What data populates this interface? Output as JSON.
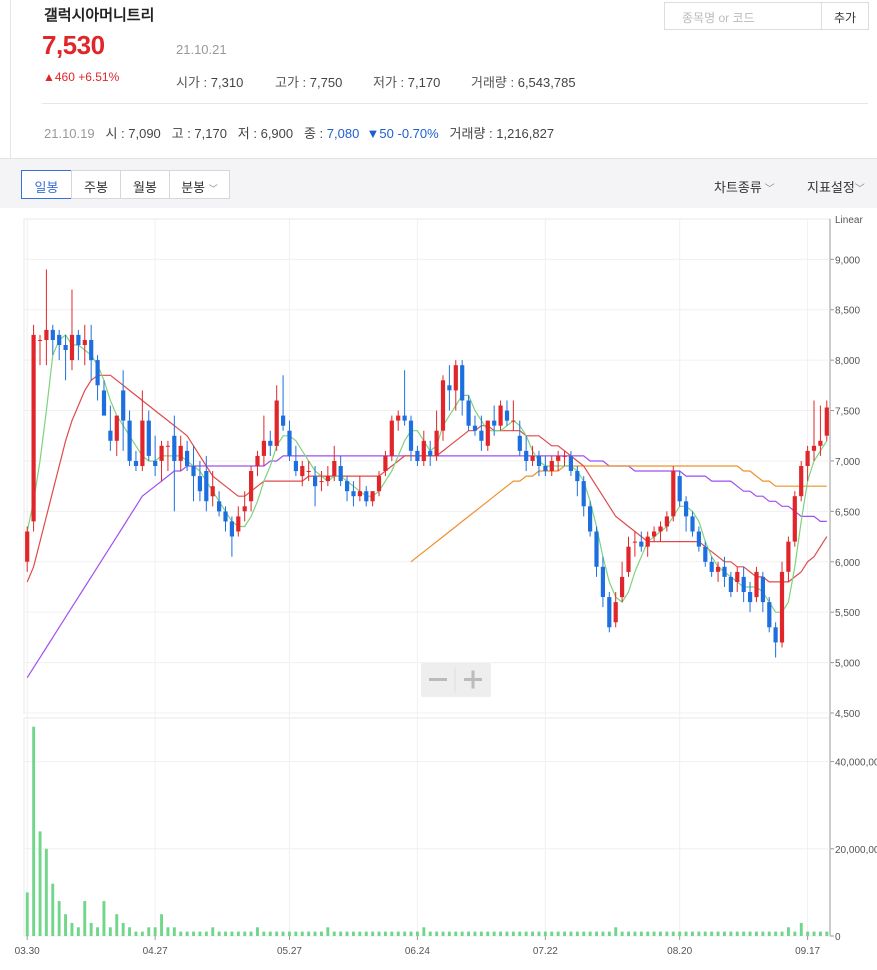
{
  "header": {
    "stock_name": "갤럭시아머니트리",
    "price": "7,530",
    "date": "21.10.21",
    "change": "▲460 +6.51%",
    "open_label": "시가 : ",
    "open": "7,310",
    "high_label": "고가 : ",
    "high": "7,750",
    "low_label": "저가 : ",
    "low": "7,170",
    "volume_label": "거래량 : ",
    "volume": "6,543,785"
  },
  "previous_day": {
    "date": "21.10.19",
    "open": "시 : 7,090",
    "high": "고 : 7,170",
    "low": "저 : 6,900",
    "close_label": "종 : ",
    "close": "7,080",
    "change": "▼50 -0.70%",
    "volume": "거래량 : 1,216,827"
  },
  "search": {
    "placeholder": "종목명 or 코드",
    "add_label": "추가"
  },
  "tabs": [
    {
      "label": "일봉",
      "active": true
    },
    {
      "label": "주봉",
      "active": false
    },
    {
      "label": "월봉",
      "active": false
    },
    {
      "label": "분봉",
      "active": false
    }
  ],
  "menus": {
    "chart_type": "차트종류",
    "indicator": "지표설정"
  },
  "colors": {
    "up": "#e0262a",
    "down": "#1d6fe0",
    "ma5": "#7dd37d",
    "ma20": "#e04a4a",
    "ma60": "#a14ff0",
    "ma120": "#f0902a",
    "volume": "#6fd68a"
  },
  "chart_data": {
    "type": "candlestick",
    "scale_label": "Linear",
    "price_ylim": [
      4500,
      9400
    ],
    "price_ticks": [
      "9,000",
      "8,500",
      "8,000",
      "7,500",
      "7,000",
      "6,500",
      "6,000",
      "5,500",
      "5,000",
      "4,500"
    ],
    "volume_ylim": [
      0,
      50000000
    ],
    "volume_ticks": [
      "40,000,00",
      "20,000,00",
      "0"
    ],
    "x_ticks": [
      "03.30",
      "04.27",
      "05.27",
      "06.24",
      "07.22",
      "08.20",
      "09.17"
    ],
    "candles": [
      [
        6000,
        6350,
        5900,
        6300
      ],
      [
        6400,
        8350,
        6300,
        8250
      ],
      [
        8200,
        8250,
        7950,
        8200
      ],
      [
        8200,
        8900,
        7950,
        8300
      ],
      [
        8300,
        8350,
        8050,
        8200
      ],
      [
        8250,
        8300,
        8000,
        8150
      ],
      [
        8150,
        8250,
        7800,
        8100
      ],
      [
        8000,
        8700,
        7900,
        8250
      ],
      [
        8250,
        8300,
        8000,
        8150
      ],
      [
        8150,
        8350,
        7950,
        8200
      ],
      [
        8200,
        8350,
        7800,
        8000
      ],
      [
        8000,
        8050,
        7600,
        7750
      ],
      [
        7700,
        7800,
        7450,
        7450
      ],
      [
        7300,
        7550,
        7100,
        7200
      ],
      [
        7200,
        7400,
        7050,
        7450
      ],
      [
        7700,
        7900,
        7100,
        7400
      ],
      [
        7400,
        7500,
        6950,
        7000
      ],
      [
        7000,
        7100,
        6900,
        6950
      ],
      [
        6950,
        7700,
        6900,
        7400
      ],
      [
        7400,
        7500,
        7000,
        7050
      ],
      [
        7000,
        7250,
        6850,
        6950
      ],
      [
        7000,
        7200,
        6800,
        7150
      ],
      [
        7150,
        7200,
        6900,
        7150
      ],
      [
        7250,
        7450,
        6500,
        7000
      ],
      [
        7000,
        7250,
        6900,
        7150
      ],
      [
        7100,
        7200,
        6900,
        6950
      ],
      [
        6950,
        7150,
        6600,
        6850
      ],
      [
        6850,
        7000,
        6600,
        6700
      ],
      [
        6900,
        7050,
        6500,
        6600
      ],
      [
        6650,
        6900,
        6550,
        6750
      ],
      [
        6600,
        6700,
        6450,
        6500
      ],
      [
        6500,
        6550,
        6300,
        6400
      ],
      [
        6400,
        6450,
        6050,
        6250
      ],
      [
        6300,
        6550,
        6250,
        6450
      ],
      [
        6500,
        6700,
        6400,
        6550
      ],
      [
        6600,
        6950,
        6500,
        6900
      ],
      [
        6950,
        7100,
        6850,
        7050
      ],
      [
        7050,
        7450,
        6950,
        7200
      ],
      [
        7200,
        7300,
        7050,
        7150
      ],
      [
        7150,
        7750,
        7100,
        7600
      ],
      [
        7450,
        7850,
        7300,
        7350
      ],
      [
        7300,
        7400,
        7000,
        7050
      ],
      [
        7000,
        7150,
        6850,
        6900
      ],
      [
        6850,
        7000,
        6750,
        6950
      ],
      [
        6900,
        7000,
        6800,
        6900
      ],
      [
        6850,
        6950,
        6550,
        6750
      ],
      [
        6800,
        6900,
        6700,
        6800
      ],
      [
        6800,
        6950,
        6750,
        6850
      ],
      [
        6850,
        7150,
        6800,
        7000
      ],
      [
        6950,
        7050,
        6750,
        6800
      ],
      [
        6800,
        6850,
        6600,
        6700
      ],
      [
        6700,
        6800,
        6550,
        6650
      ],
      [
        6650,
        6850,
        6600,
        6700
      ],
      [
        6700,
        6750,
        6550,
        6600
      ],
      [
        6600,
        6700,
        6550,
        6700
      ],
      [
        6700,
        6900,
        6650,
        6850
      ],
      [
        6900,
        7100,
        6850,
        7050
      ],
      [
        7050,
        7450,
        7000,
        7400
      ],
      [
        7400,
        7500,
        7300,
        7450
      ],
      [
        7450,
        7900,
        7350,
        7400
      ],
      [
        7400,
        7450,
        7000,
        7100
      ],
      [
        7100,
        7150,
        6950,
        7000
      ],
      [
        7000,
        7300,
        6950,
        7200
      ],
      [
        7100,
        7200,
        6950,
        7050
      ],
      [
        7050,
        7500,
        7000,
        7300
      ],
      [
        7300,
        7850,
        7200,
        7800
      ],
      [
        7750,
        7950,
        7500,
        7700
      ],
      [
        7700,
        8000,
        7500,
        7950
      ],
      [
        7950,
        8000,
        7450,
        7600
      ],
      [
        7600,
        7650,
        7300,
        7350
      ],
      [
        7350,
        7450,
        7250,
        7300
      ],
      [
        7300,
        7450,
        7100,
        7200
      ],
      [
        7150,
        7400,
        7100,
        7400
      ],
      [
        7400,
        7550,
        7250,
        7350
      ],
      [
        7350,
        7600,
        7300,
        7550
      ],
      [
        7500,
        7600,
        7350,
        7400
      ],
      [
        7400,
        7600,
        7300,
        7400
      ],
      [
        7250,
        7400,
        7050,
        7100
      ],
      [
        7100,
        7250,
        6900,
        7000
      ],
      [
        7000,
        7150,
        6950,
        7050
      ],
      [
        7050,
        7100,
        6850,
        6950
      ],
      [
        6950,
        7050,
        6850,
        6900
      ],
      [
        6900,
        7050,
        6850,
        7000
      ],
      [
        7000,
        7100,
        6900,
        7050
      ],
      [
        7050,
        7100,
        6950,
        7050
      ],
      [
        7050,
        7100,
        6850,
        6900
      ],
      [
        6900,
        6950,
        6650,
        6800
      ],
      [
        6800,
        6850,
        6450,
        6550
      ],
      [
        6550,
        6600,
        6250,
        6300
      ],
      [
        6300,
        6350,
        5850,
        5950
      ],
      [
        5950,
        6050,
        5550,
        5650
      ],
      [
        5650,
        5700,
        5300,
        5350
      ],
      [
        5400,
        5700,
        5350,
        5600
      ],
      [
        5650,
        6000,
        5600,
        5850
      ],
      [
        5900,
        6250,
        5850,
        6150
      ],
      [
        6200,
        6300,
        6050,
        6200
      ],
      [
        6200,
        6300,
        6100,
        6150
      ],
      [
        6150,
        6300,
        6050,
        6250
      ],
      [
        6250,
        6350,
        6200,
        6300
      ],
      [
        6300,
        6400,
        6200,
        6350
      ],
      [
        6350,
        6500,
        6300,
        6450
      ],
      [
        6450,
        6950,
        6400,
        6900
      ],
      [
        6850,
        6900,
        6550,
        6600
      ],
      [
        6600,
        6650,
        6300,
        6450
      ],
      [
        6450,
        6500,
        6250,
        6300
      ],
      [
        6300,
        6350,
        6100,
        6150
      ],
      [
        6150,
        6200,
        5950,
        6000
      ],
      [
        6000,
        6050,
        5850,
        5900
      ],
      [
        5900,
        6000,
        5800,
        5950
      ],
      [
        5950,
        6050,
        5750,
        5850
      ],
      [
        5850,
        5900,
        5650,
        5700
      ],
      [
        5800,
        5950,
        5700,
        5900
      ],
      [
        5850,
        5950,
        5600,
        5700
      ],
      [
        5700,
        5800,
        5500,
        5600
      ],
      [
        5650,
        5950,
        5600,
        5900
      ],
      [
        5850,
        5900,
        5500,
        5600
      ],
      [
        5600,
        5650,
        5300,
        5350
      ],
      [
        5350,
        5400,
        5050,
        5200
      ],
      [
        5200,
        6000,
        5150,
        5900
      ],
      [
        5900,
        6250,
        5800,
        6200
      ],
      [
        6200,
        6700,
        6150,
        6650
      ],
      [
        6650,
        7000,
        6600,
        6950
      ],
      [
        6950,
        7150,
        6800,
        7100
      ],
      [
        7100,
        7600,
        7000,
        7150
      ],
      [
        7150,
        7550,
        7050,
        7200
      ],
      [
        7250,
        7600,
        7200,
        7530
      ]
    ],
    "ma5": [
      6300,
      6600,
      7000,
      7500,
      8050,
      8200,
      8250,
      8150,
      8150,
      8100,
      8050,
      7950,
      7800,
      7600,
      7450,
      7350,
      7250,
      7150,
      7050,
      7000,
      7000,
      7050,
      7050,
      7050,
      7050,
      7000,
      6950,
      6900,
      6800,
      6700,
      6600,
      6500,
      6400,
      6350,
      6350,
      6450,
      6600,
      6800,
      6950,
      7150,
      7250,
      7250,
      7200,
      7100,
      7000,
      6900,
      6850,
      6800,
      6850,
      6850,
      6800,
      6750,
      6700,
      6650,
      6650,
      6700,
      6800,
      6900,
      7050,
      7200,
      7300,
      7300,
      7200,
      7100,
      7150,
      7350,
      7450,
      7550,
      7650,
      7650,
      7500,
      7400,
      7300,
      7300,
      7300,
      7350,
      7400,
      7350,
      7250,
      7100,
      7000,
      6950,
      6950,
      6950,
      6950,
      6950,
      6900,
      6800,
      6600,
      6350,
      6050,
      5800,
      5650,
      5600,
      5700,
      5900,
      6050,
      6200,
      6250,
      6300,
      6350,
      6450,
      6550,
      6550,
      6500,
      6400,
      6200,
      6050,
      5950,
      5900,
      5850,
      5800,
      5750,
      5750,
      5750,
      5700,
      5600,
      5500,
      5500,
      5600,
      5950,
      6400,
      6800,
      7000,
      7100,
      7200
    ],
    "ma20": [
      5800,
      5950,
      6200,
      6450,
      6700,
      6950,
      7200,
      7400,
      7550,
      7700,
      7800,
      7850,
      7850,
      7850,
      7800,
      7750,
      7700,
      7650,
      7600,
      7550,
      7500,
      7450,
      7400,
      7350,
      7300,
      7250,
      7150,
      7050,
      6950,
      6850,
      6800,
      6750,
      6700,
      6650,
      6650,
      6700,
      6750,
      6800,
      6800,
      6800,
      6800,
      6800,
      6800,
      6800,
      6850,
      6850,
      6850,
      6850,
      6850,
      6850,
      6850,
      6850,
      6850,
      6850,
      6850,
      6850,
      6900,
      6950,
      7000,
      7050,
      7050,
      7050,
      7050,
      7050,
      7050,
      7100,
      7150,
      7200,
      7250,
      7300,
      7300,
      7350,
      7350,
      7300,
      7300,
      7300,
      7300,
      7300,
      7250,
      7250,
      7250,
      7200,
      7150,
      7150,
      7100,
      7050,
      7000,
      6950,
      6850,
      6750,
      6650,
      6550,
      6450,
      6400,
      6350,
      6300,
      6250,
      6200,
      6200,
      6200,
      6200,
      6200,
      6200,
      6200,
      6200,
      6200,
      6150,
      6100,
      6050,
      6000,
      6000,
      5950,
      5950,
      5900,
      5850,
      5850,
      5800,
      5800,
      5800,
      5800,
      5850,
      5900,
      6000,
      6050,
      6150,
      6250
    ],
    "ma60": {
      "start": 0,
      "values": [
        4850,
        4950,
        5050,
        5150,
        5250,
        5350,
        5450,
        5550,
        5650,
        5750,
        5850,
        5950,
        6050,
        6150,
        6250,
        6350,
        6450,
        6550,
        6650,
        6700,
        6750,
        6800,
        6850,
        6900,
        6900,
        6950,
        6950,
        6950,
        6950,
        6950,
        6950,
        6950,
        6950,
        6950,
        6950,
        6950,
        6950,
        6950,
        7000,
        7000,
        7050,
        7050,
        7050,
        7050,
        7050,
        7050,
        7050,
        7050,
        7050,
        7050,
        7050,
        7050,
        7050,
        7050,
        7050,
        7050,
        7050,
        7050,
        7050,
        7050,
        7050,
        7050,
        7050,
        7050,
        7050,
        7050,
        7050,
        7050,
        7050,
        7050,
        7050,
        7050,
        7050,
        7050,
        7050,
        7050,
        7050,
        7050,
        7050,
        7050,
        7050,
        7050,
        7050,
        7050,
        7050,
        7050,
        7050,
        7050,
        7000,
        7000,
        7000,
        6950,
        6950,
        6950,
        6950,
        6900,
        6900,
        6900,
        6900,
        6900,
        6900,
        6900,
        6900,
        6850,
        6850,
        6850,
        6850,
        6800,
        6800,
        6800,
        6800,
        6750,
        6700,
        6700,
        6650,
        6650,
        6600,
        6600,
        6550,
        6550,
        6500,
        6450,
        6450,
        6450,
        6400,
        6400
      ]
    },
    "ma120": {
      "start": 60,
      "values": [
        6000,
        6050,
        6100,
        6150,
        6200,
        6250,
        6300,
        6350,
        6400,
        6450,
        6500,
        6550,
        6600,
        6650,
        6700,
        6750,
        6800,
        6800,
        6850,
        6850,
        6900,
        6900,
        6900,
        6900,
        6950,
        6950,
        6950,
        6950,
        6950,
        6950,
        6950,
        6950,
        6950,
        6950,
        6950,
        6950,
        6950,
        6950,
        6950,
        6950,
        6950,
        6950,
        6950,
        6950,
        6950,
        6950,
        6950,
        6950,
        6950,
        6950,
        6950,
        6950,
        6900,
        6900,
        6850,
        6800,
        6800,
        6750,
        6750,
        6750,
        6750,
        6750,
        6750,
        6750,
        6750,
        6750
      ]
    },
    "volumes": [
      10,
      48,
      24,
      20,
      12,
      8,
      5,
      3,
      2,
      8,
      3,
      2,
      8,
      2,
      5,
      3,
      2,
      1,
      1,
      2,
      2,
      5,
      2,
      2,
      1,
      1,
      1,
      1,
      1,
      2,
      1,
      1,
      1,
      1,
      1,
      1,
      2,
      1,
      1,
      1,
      1,
      1,
      1,
      1,
      1,
      1,
      1,
      2,
      1,
      1,
      1,
      1,
      1,
      1,
      1,
      1,
      1,
      1,
      1,
      1,
      1,
      1,
      2,
      1,
      1,
      1,
      1,
      1,
      1,
      1,
      1,
      1,
      1,
      1,
      1,
      1,
      1,
      1,
      1,
      1,
      1,
      1,
      1,
      1,
      1,
      1,
      1,
      1,
      1,
      1,
      1,
      1,
      2,
      1,
      1,
      1,
      1,
      1,
      1,
      1,
      1,
      1,
      1,
      1,
      1,
      1,
      1,
      1,
      1,
      1,
      1,
      1,
      1,
      1,
      1,
      1,
      1,
      1,
      1,
      2,
      1,
      3,
      1,
      1,
      1,
      1,
      5,
      3,
      2,
      16,
      2,
      5,
      3
    ]
  }
}
